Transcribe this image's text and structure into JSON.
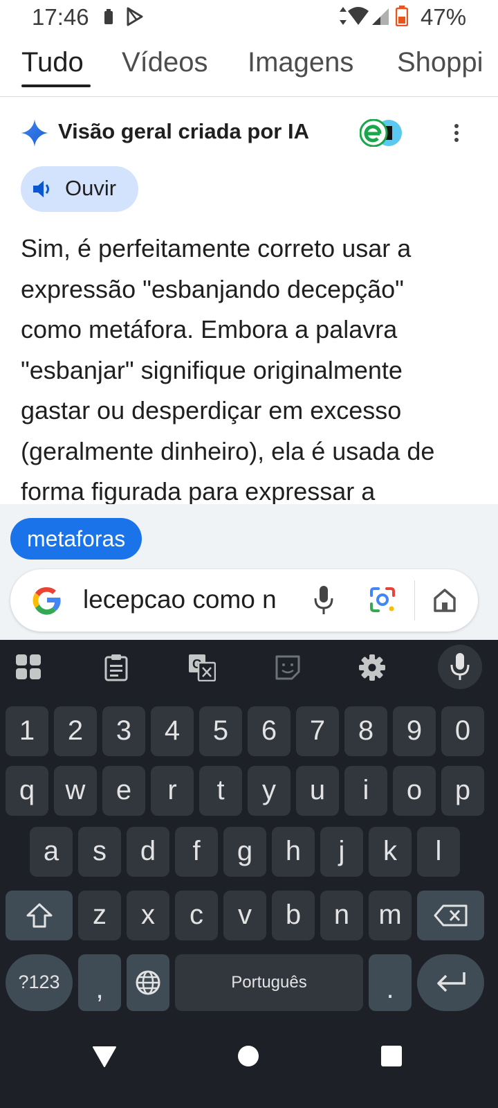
{
  "status_bar": {
    "time": "17:46",
    "battery_percent": "47%"
  },
  "tabs": [
    {
      "label": "Tudo",
      "active": true
    },
    {
      "label": "Vídeos",
      "active": false
    },
    {
      "label": "Imagens",
      "active": false
    },
    {
      "label": "Shoppi",
      "active": false
    }
  ],
  "ai_overview": {
    "title": "Visão geral criada por IA",
    "listen_label": "Ouvir",
    "body_lines": [
      "Sim, é perfeitamente correto usar a",
      "expressão \"esbanjando decepção\"",
      "como metáfora. Embora a palavra",
      "\"esbanjar\" signifique originalmente",
      "gastar ou desperdiçar em excesso",
      "(geralmente dinheiro), ela é usada de",
      "forma figurada para expressar a"
    ]
  },
  "suggestion_chip": "metaforas",
  "search": {
    "query_visible": "lecepcao como n"
  },
  "keyboard": {
    "number_row": [
      "1",
      "2",
      "3",
      "4",
      "5",
      "6",
      "7",
      "8",
      "9",
      "0"
    ],
    "row1": [
      "q",
      "w",
      "e",
      "r",
      "t",
      "y",
      "u",
      "i",
      "o",
      "p"
    ],
    "row2": [
      "a",
      "s",
      "d",
      "f",
      "g",
      "h",
      "j",
      "k",
      "l"
    ],
    "row3": [
      "z",
      "x",
      "c",
      "v",
      "b",
      "n",
      "m"
    ],
    "symbols_label": "?123",
    "comma": ",",
    "space_label": "Português",
    "period": "."
  },
  "colors": {
    "accent": "#1a73e8",
    "listen_bg": "#d3e3fd",
    "keyboard_bg": "#1d2127",
    "key_bg": "#32373e"
  }
}
